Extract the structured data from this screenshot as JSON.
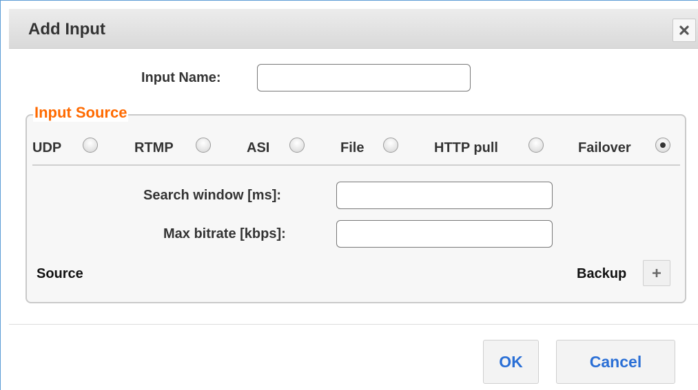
{
  "dialog": {
    "title": "Add Input",
    "close_icon": "close-icon"
  },
  "input_name": {
    "label": "Input Name:",
    "value": ""
  },
  "input_source": {
    "legend": "Input Source",
    "options": [
      {
        "label": "UDP",
        "checked": false
      },
      {
        "label": "RTMP",
        "checked": false
      },
      {
        "label": "ASI",
        "checked": false
      },
      {
        "label": "File",
        "checked": false
      },
      {
        "label": "HTTP pull",
        "checked": false
      },
      {
        "label": "Failover",
        "checked": true
      }
    ],
    "selected": "Failover"
  },
  "failover": {
    "search_window_label": "Search window [ms]:",
    "search_window_value": "",
    "max_bitrate_label": "Max bitrate [kbps]:",
    "max_bitrate_value": "",
    "source_label": "Source",
    "backup_label": "Backup",
    "add_icon": "plus-icon"
  },
  "buttons": {
    "ok": "OK",
    "cancel": "Cancel"
  },
  "colors": {
    "legend": "#ff6a00",
    "button_text": "#2a6fd6"
  }
}
